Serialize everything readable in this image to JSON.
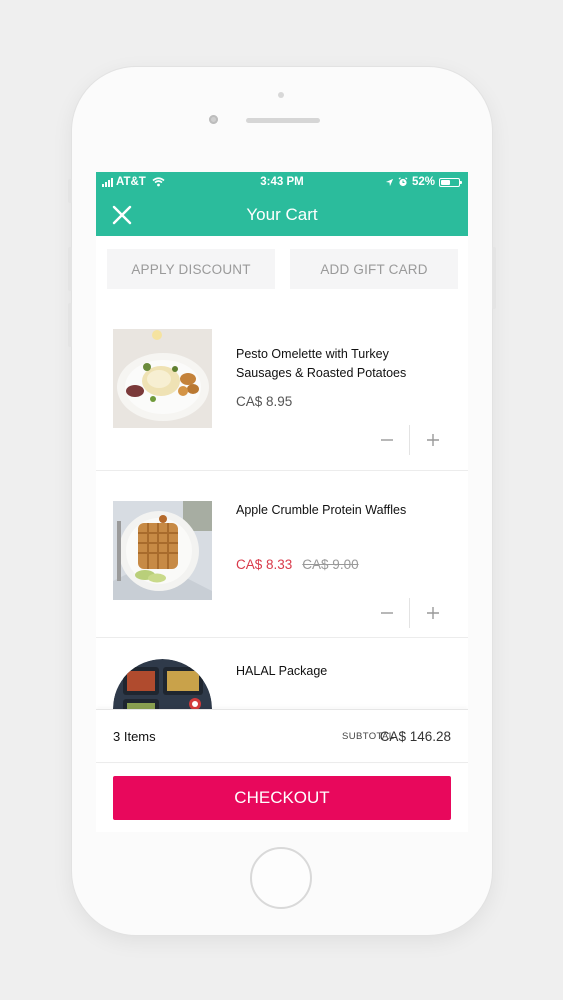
{
  "status_bar": {
    "carrier": "AT&T",
    "time": "3:43 PM",
    "battery": "52%",
    "battery_level": 0.52
  },
  "nav": {
    "title": "Your Cart",
    "close_icon": "close-icon"
  },
  "actions": {
    "apply_discount": "APPLY DISCOUNT",
    "add_gift_card": "ADD GIFT CARD"
  },
  "cart": {
    "items": [
      {
        "name": "Pesto Omelette with Turkey Sausages & Roasted Potatoes",
        "price": "CA$ 8.95",
        "sale_price": "",
        "original_price": ""
      },
      {
        "name": "Apple Crumble Protein Waffles",
        "price": "",
        "sale_price": "CA$ 8.33",
        "original_price": "CA$ 9.00"
      },
      {
        "name": "HALAL Package",
        "price": "",
        "sale_price": "",
        "original_price": ""
      }
    ],
    "qty_minus_symbol": "−",
    "qty_plus_symbol": "+"
  },
  "summary": {
    "items_count": "3 Items",
    "subtotal_label": "SUBTOTAL",
    "subtotal_value": "CA$ 146.28"
  },
  "checkout_label": "CHECKOUT",
  "colors": {
    "header": "#2bbc9c",
    "checkout": "#e8085c",
    "sale_price": "#d93a4a"
  }
}
